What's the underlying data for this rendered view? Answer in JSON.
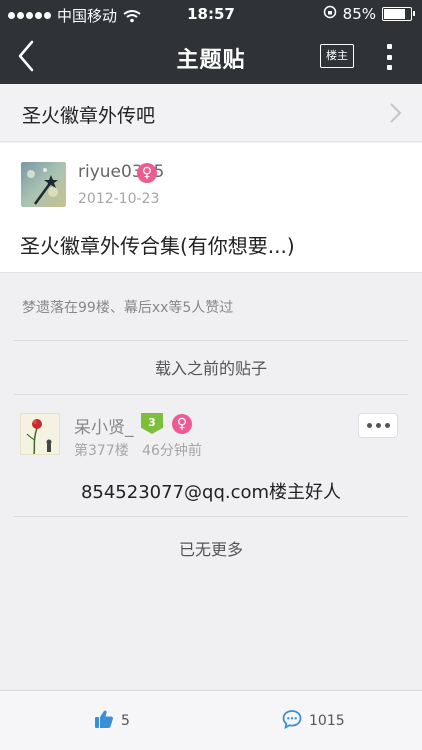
{
  "status_bar": {
    "carrier": "中国移动",
    "time": "18:57",
    "battery": "85%",
    "battery_level": 0.85
  },
  "nav": {
    "title": "主题贴",
    "louzhu_label": "楼主"
  },
  "forum": {
    "name": "圣火徽章外传吧"
  },
  "post": {
    "username": "riyue0325",
    "date": "2012-10-23",
    "title": "圣火徽章外传合集(有你想要...)"
  },
  "likes_text": "梦遗落在99楼、幕后xx等5人赞过",
  "load_previous": "载入之前的贴子",
  "reply": {
    "username": "呆小贤_",
    "level": "3",
    "floor": "第377楼",
    "time_ago": "46分钟前",
    "content": "854523077@qq.com楼主好人"
  },
  "no_more": "已无更多",
  "bottom_bar": {
    "likes": "5",
    "comments": "1015"
  },
  "colors": {
    "nav_bg": "#2f3338",
    "female_badge": "#ec5b92",
    "level_badge": "#7dbe3a",
    "accent_blue": "#3b8fd6"
  },
  "icons": [
    "back-icon",
    "more-icon",
    "chevron-right-icon",
    "female-icon",
    "thumbs-up-icon",
    "comment-icon",
    "wifi-icon",
    "battery-icon"
  ]
}
